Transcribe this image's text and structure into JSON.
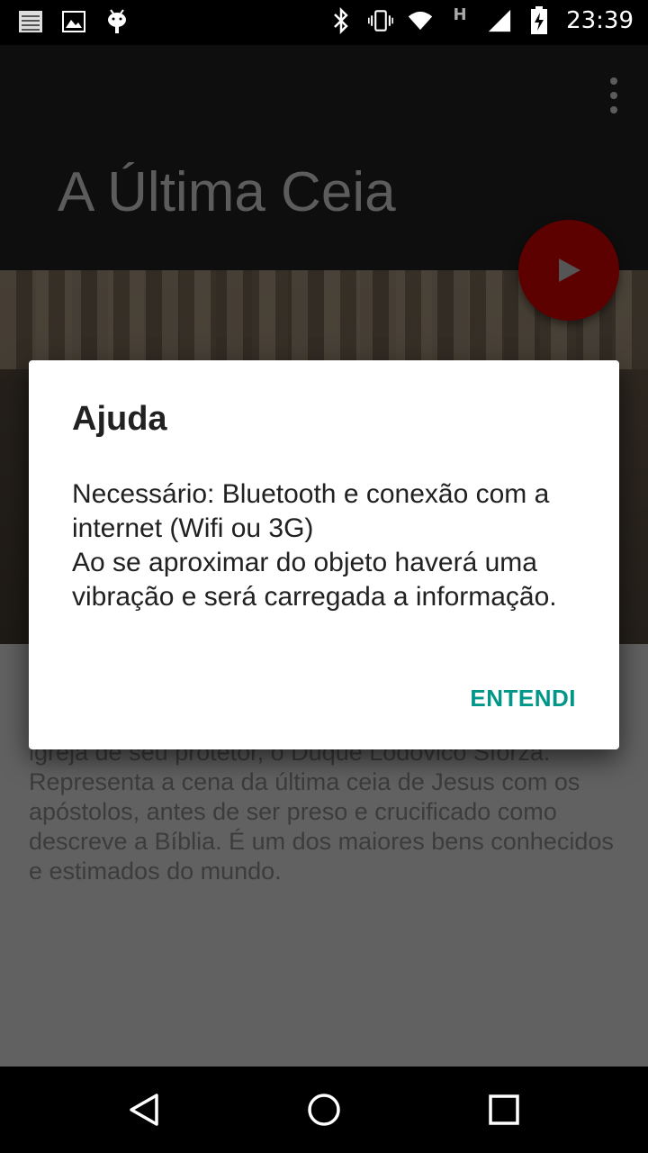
{
  "status_bar": {
    "time": "23:39",
    "network_type": "H",
    "left_icons": [
      "notes-icon",
      "image-icon",
      "android-icon"
    ],
    "right_icons": [
      "bluetooth-icon",
      "vibrate-icon",
      "wifi-icon",
      "signal-icon",
      "battery-charging-icon"
    ]
  },
  "toolbar": {
    "title": "A Última Ceia"
  },
  "content": {
    "description": "igreja de seu protetor, o Duque Lodovico Sforza.\nRepresenta a cena da última ceia de Jesus com os apóstolos, antes de ser preso e crucificado como descreve a Bíblia. É um dos maiores bens conhecidos e estimados do mundo."
  },
  "dialog": {
    "title": "Ajuda",
    "message": "Necessário: Bluetooth e conexão com a internet (Wifi ou 3G)\nAo se aproximar do objeto haverá uma vibração e será carregada a informação.",
    "button_label": "ENTENDI"
  },
  "colors": {
    "accent": "#009688",
    "fab": "#5c0000"
  }
}
